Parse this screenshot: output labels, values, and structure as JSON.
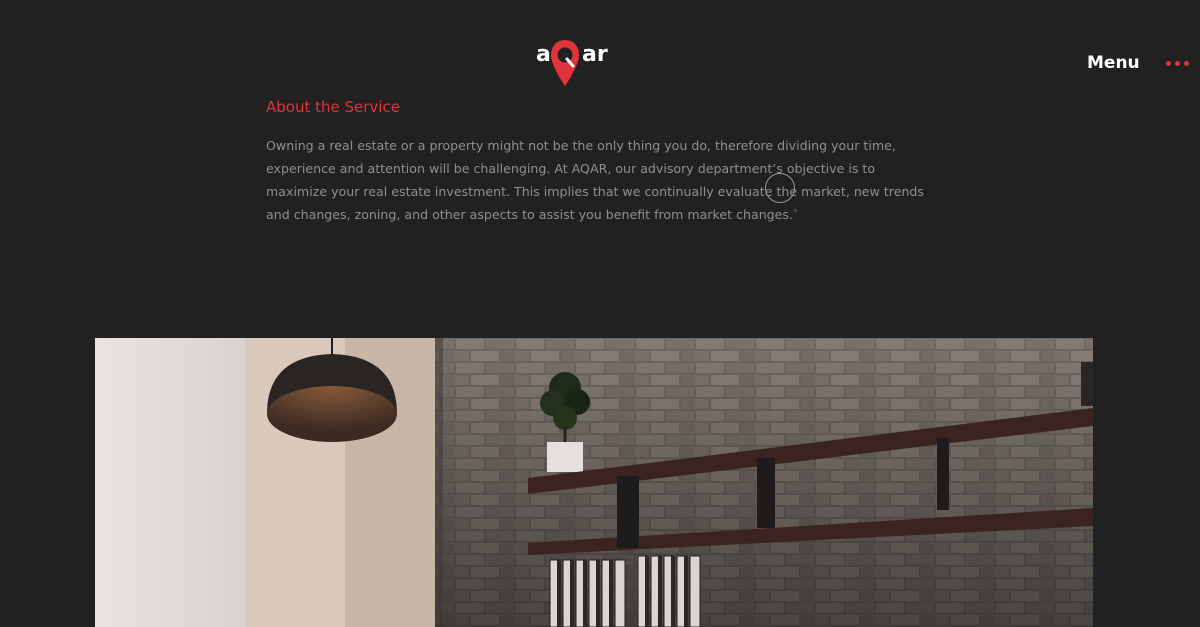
{
  "header": {
    "logo": {
      "text_left": "a",
      "text_right": "ar",
      "pin_letter": "Q"
    },
    "menu_label": "Menu",
    "menu_icon": "three-dots-icon"
  },
  "about": {
    "title": "About the Service",
    "body": "Owning a real estate or a property might not be the only thing you do, therefore dividing your time, experience and attention will be challenging. At AQAR, our advisory department’s objective is to maximize your real estate investment. This implies that we continually evaluate the market, new trends and changes, zoning, and other aspects to assist you benefit from market changes.`"
  },
  "hero_image": {
    "alt": "interior-office-photo"
  },
  "colors": {
    "background": "#212121",
    "accent": "#e0343a",
    "text_muted": "#8f8f8f",
    "white": "#ffffff"
  }
}
